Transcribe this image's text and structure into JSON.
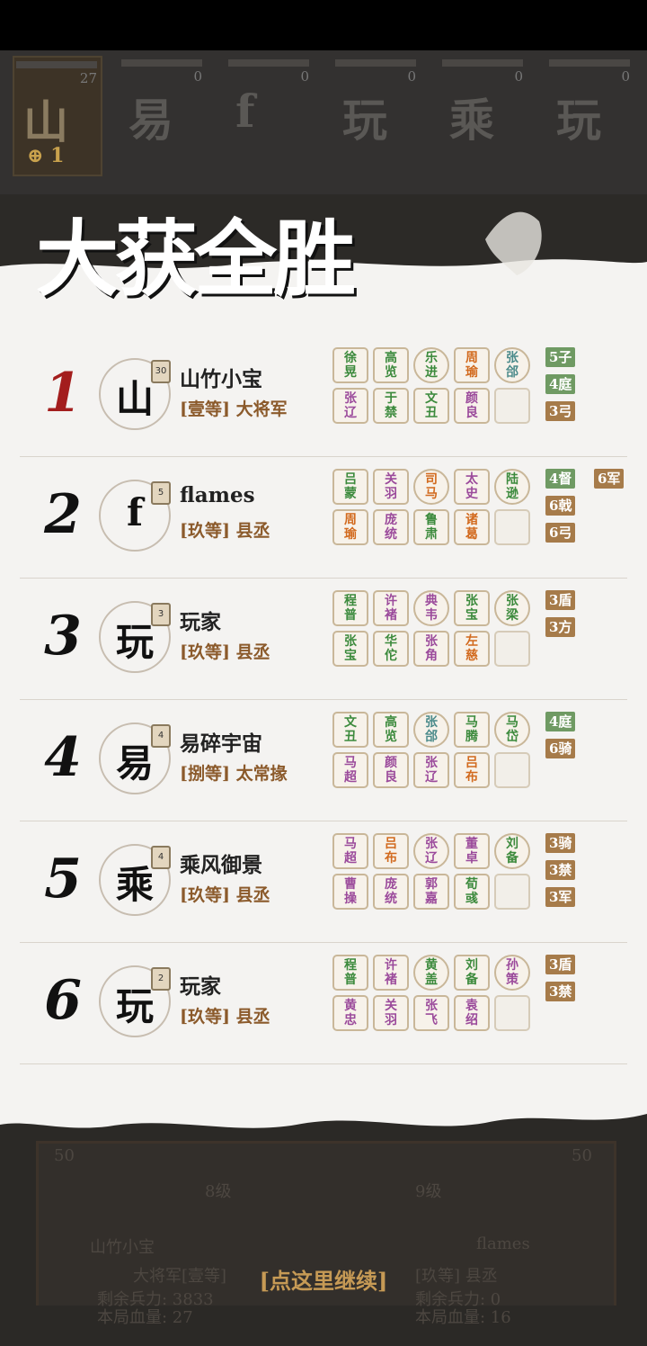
{
  "players_bar": [
    {
      "glyph": "山",
      "count": "27",
      "coin": "1",
      "active": true
    },
    {
      "glyph": "易",
      "count": "0"
    },
    {
      "glyph": "f",
      "count": "0"
    },
    {
      "glyph": "玩",
      "count": "0"
    },
    {
      "glyph": "乘",
      "count": "0"
    },
    {
      "glyph": "玩",
      "count": "0"
    }
  ],
  "banner": {
    "title": "大获全胜"
  },
  "rows": [
    {
      "rank": "1",
      "glyph": "山",
      "level": "30",
      "name": "山竹小宝",
      "title": "[壹等] 大将军",
      "heroes": [
        [
          "徐晃",
          "#3c8a3c"
        ],
        [
          "高览",
          "#3c8a3c"
        ],
        [
          "乐进",
          "#3c8a3c"
        ],
        [
          "周瑜",
          "#d26a1e"
        ],
        [
          "张郃",
          "#4a8a8a"
        ],
        [
          "张辽",
          "#9b4a9b"
        ],
        [
          "于禁",
          "#3c8a3c"
        ],
        [
          "文丑",
          "#3c8a3c"
        ],
        [
          "颜良",
          "#9b4a9b"
        ]
      ],
      "tags": [
        [
          "5子",
          "#6f9a63"
        ],
        [
          "4庭",
          "#6f9a63"
        ],
        [
          "3弓",
          "#a67b4a"
        ]
      ]
    },
    {
      "rank": "2",
      "glyph": "f",
      "level": "5",
      "name": "flames",
      "title": "[玖等] 县丞",
      "heroes": [
        [
          "吕蒙",
          "#3c8a3c"
        ],
        [
          "关羽",
          "#9b4a9b"
        ],
        [
          "司马",
          "#d26a1e"
        ],
        [
          "太史",
          "#9b4a9b"
        ],
        [
          "陆逊",
          "#3c8a3c"
        ],
        [
          "周瑜",
          "#d26a1e"
        ],
        [
          "庞统",
          "#9b4a9b"
        ],
        [
          "鲁肃",
          "#3c8a3c"
        ],
        [
          "诸葛",
          "#d26a1e"
        ]
      ],
      "tags": [
        [
          "4督",
          "#6f9a63"
        ],
        [
          "6军",
          "#a67b4a"
        ],
        [
          "6戟",
          "#a67b4a"
        ],
        [
          "6弓",
          "#a67b4a"
        ]
      ]
    },
    {
      "rank": "3",
      "glyph": "玩",
      "level": "3",
      "name": "玩家",
      "title": "[玖等] 县丞",
      "heroes": [
        [
          "程普",
          "#3c8a3c"
        ],
        [
          "许褚",
          "#9b4a9b"
        ],
        [
          "典韦",
          "#9b4a9b"
        ],
        [
          "张宝",
          "#3c8a3c"
        ],
        [
          "张梁",
          "#3c8a3c"
        ],
        [
          "张宝",
          "#3c8a3c"
        ],
        [
          "华佗",
          "#3c8a3c"
        ],
        [
          "张角",
          "#9b4a9b"
        ],
        [
          "左慈",
          "#d26a1e"
        ]
      ],
      "tags": [
        [
          "3盾",
          "#a67b4a"
        ],
        [
          "3方",
          "#a67b4a"
        ]
      ]
    },
    {
      "rank": "4",
      "glyph": "易",
      "level": "4",
      "name": "易碎宇宙",
      "title": "[捌等] 太常掾",
      "heroes": [
        [
          "文丑",
          "#3c8a3c"
        ],
        [
          "高览",
          "#3c8a3c"
        ],
        [
          "张郃",
          "#4a8a8a"
        ],
        [
          "马腾",
          "#3c8a3c"
        ],
        [
          "马岱",
          "#3c8a3c"
        ],
        [
          "马超",
          "#9b4a9b"
        ],
        [
          "颜良",
          "#9b4a9b"
        ],
        [
          "张辽",
          "#9b4a9b"
        ],
        [
          "吕布",
          "#d26a1e"
        ]
      ],
      "tags": [
        [
          "4庭",
          "#6f9a63"
        ],
        [
          "6骑",
          "#a67b4a"
        ]
      ]
    },
    {
      "rank": "5",
      "glyph": "乘",
      "level": "4",
      "name": "乘风御景",
      "title": "[玖等] 县丞",
      "heroes": [
        [
          "马超",
          "#9b4a9b"
        ],
        [
          "吕布",
          "#d26a1e"
        ],
        [
          "张辽",
          "#9b4a9b"
        ],
        [
          "董卓",
          "#9b4a9b"
        ],
        [
          "刘备",
          "#3c8a3c"
        ],
        [
          "曹操",
          "#9b4a9b"
        ],
        [
          "庞统",
          "#9b4a9b"
        ],
        [
          "郭嘉",
          "#9b4a9b"
        ],
        [
          "荀彧",
          "#3c8a3c"
        ]
      ],
      "tags": [
        [
          "3骑",
          "#a67b4a"
        ],
        [
          "3禁",
          "#a67b4a"
        ],
        [
          "3军",
          "#a67b4a"
        ]
      ]
    },
    {
      "rank": "6",
      "glyph": "玩",
      "level": "2",
      "name": "玩家",
      "title": "[玖等] 县丞",
      "heroes": [
        [
          "程普",
          "#3c8a3c"
        ],
        [
          "许褚",
          "#9b4a9b"
        ],
        [
          "黄盖",
          "#3c8a3c"
        ],
        [
          "刘备",
          "#3c8a3c"
        ],
        [
          "孙策",
          "#9b4a9b"
        ],
        [
          "黄忠",
          "#9b4a9b"
        ],
        [
          "关羽",
          "#9b4a9b"
        ],
        [
          "张飞",
          "#9b4a9b"
        ],
        [
          "袁绍",
          "#9b4a9b"
        ]
      ],
      "tags": [
        [
          "3盾",
          "#a67b4a"
        ],
        [
          "3禁",
          "#a67b4a"
        ]
      ]
    }
  ],
  "bottom": {
    "left_num": "50",
    "right_num": "50",
    "left_level": "8级",
    "right_level": "9级",
    "left_name": "山竹小宝",
    "left_title": "大将军[壹等]",
    "right_name": "flames",
    "right_title": "[玖等] 县丞",
    "left_troops": "剩余兵力: 3833",
    "left_hp": "本局血量: 27",
    "right_troops": "剩余兵力: 0",
    "right_hp": "本局血量: 16",
    "continue": "[点这里继续]"
  }
}
